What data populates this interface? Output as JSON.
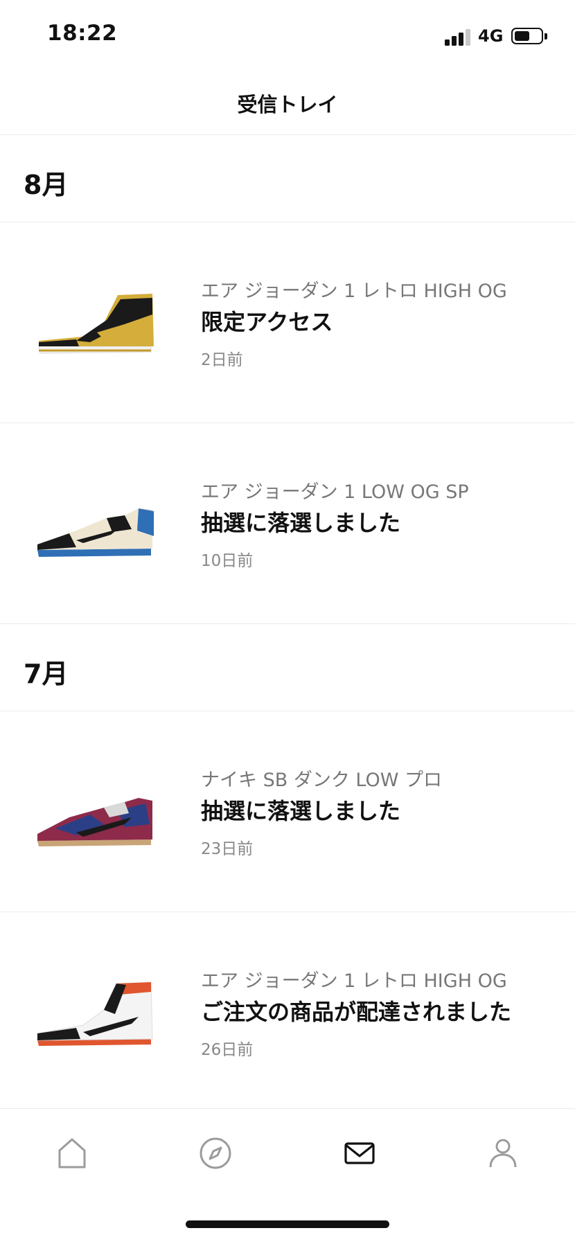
{
  "status_bar": {
    "time": "18:22",
    "network": "4G",
    "battery_level": 0.55
  },
  "header": {
    "title": "受信トレイ"
  },
  "sections": [
    {
      "month": "8月"
    },
    {
      "month": "7月"
    }
  ],
  "notifications": [
    {
      "subtitle": "エア ジョーダン 1 レトロ HIGH OG",
      "title": "限定アクセス",
      "time": "2日前",
      "colors": {
        "base": "#d4ad3a",
        "accent": "#1a1a1a",
        "sole": "#f2f2f2"
      }
    },
    {
      "subtitle": "エア ジョーダン 1 LOW OG SP",
      "title": "抽選に落選しました",
      "time": "10日前",
      "colors": {
        "base": "#efe6d2",
        "accent": "#1a1a1a",
        "sole": "#2f6fb5"
      }
    },
    {
      "subtitle": "ナイキ SB ダンク LOW プロ",
      "title": "抽選に落選しました",
      "time": "23日前",
      "colors": {
        "base": "#8e2a4a",
        "accent": "#2b3f86",
        "sole": "#c8a477"
      }
    },
    {
      "subtitle": "エア ジョーダン 1 レトロ HIGH OG",
      "title": "ご注文の商品が配達されました",
      "time": "26日前",
      "colors": {
        "base": "#f4f4f4",
        "accent": "#1a1a1a",
        "sole": "#e0562f"
      }
    }
  ],
  "tab_bar": {
    "tabs": [
      {
        "name": "home-icon",
        "active": false
      },
      {
        "name": "compass-icon",
        "active": false
      },
      {
        "name": "mail-icon",
        "active": true
      },
      {
        "name": "profile-icon",
        "active": false
      }
    ]
  }
}
